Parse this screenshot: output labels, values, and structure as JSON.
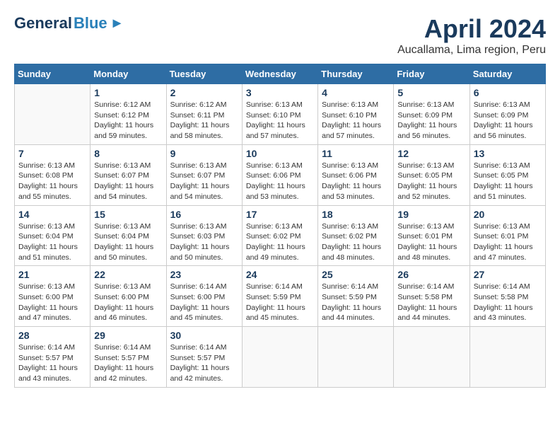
{
  "header": {
    "logo_general": "General",
    "logo_blue": "Blue",
    "title": "April 2024",
    "subtitle": "Aucallama, Lima region, Peru"
  },
  "calendar": {
    "days_of_week": [
      "Sunday",
      "Monday",
      "Tuesday",
      "Wednesday",
      "Thursday",
      "Friday",
      "Saturday"
    ],
    "weeks": [
      [
        {
          "day": "",
          "info": ""
        },
        {
          "day": "1",
          "info": "Sunrise: 6:12 AM\nSunset: 6:12 PM\nDaylight: 11 hours\nand 59 minutes."
        },
        {
          "day": "2",
          "info": "Sunrise: 6:12 AM\nSunset: 6:11 PM\nDaylight: 11 hours\nand 58 minutes."
        },
        {
          "day": "3",
          "info": "Sunrise: 6:13 AM\nSunset: 6:10 PM\nDaylight: 11 hours\nand 57 minutes."
        },
        {
          "day": "4",
          "info": "Sunrise: 6:13 AM\nSunset: 6:10 PM\nDaylight: 11 hours\nand 57 minutes."
        },
        {
          "day": "5",
          "info": "Sunrise: 6:13 AM\nSunset: 6:09 PM\nDaylight: 11 hours\nand 56 minutes."
        },
        {
          "day": "6",
          "info": "Sunrise: 6:13 AM\nSunset: 6:09 PM\nDaylight: 11 hours\nand 56 minutes."
        }
      ],
      [
        {
          "day": "7",
          "info": "Sunrise: 6:13 AM\nSunset: 6:08 PM\nDaylight: 11 hours\nand 55 minutes."
        },
        {
          "day": "8",
          "info": "Sunrise: 6:13 AM\nSunset: 6:07 PM\nDaylight: 11 hours\nand 54 minutes."
        },
        {
          "day": "9",
          "info": "Sunrise: 6:13 AM\nSunset: 6:07 PM\nDaylight: 11 hours\nand 54 minutes."
        },
        {
          "day": "10",
          "info": "Sunrise: 6:13 AM\nSunset: 6:06 PM\nDaylight: 11 hours\nand 53 minutes."
        },
        {
          "day": "11",
          "info": "Sunrise: 6:13 AM\nSunset: 6:06 PM\nDaylight: 11 hours\nand 53 minutes."
        },
        {
          "day": "12",
          "info": "Sunrise: 6:13 AM\nSunset: 6:05 PM\nDaylight: 11 hours\nand 52 minutes."
        },
        {
          "day": "13",
          "info": "Sunrise: 6:13 AM\nSunset: 6:05 PM\nDaylight: 11 hours\nand 51 minutes."
        }
      ],
      [
        {
          "day": "14",
          "info": "Sunrise: 6:13 AM\nSunset: 6:04 PM\nDaylight: 11 hours\nand 51 minutes."
        },
        {
          "day": "15",
          "info": "Sunrise: 6:13 AM\nSunset: 6:04 PM\nDaylight: 11 hours\nand 50 minutes."
        },
        {
          "day": "16",
          "info": "Sunrise: 6:13 AM\nSunset: 6:03 PM\nDaylight: 11 hours\nand 50 minutes."
        },
        {
          "day": "17",
          "info": "Sunrise: 6:13 AM\nSunset: 6:02 PM\nDaylight: 11 hours\nand 49 minutes."
        },
        {
          "day": "18",
          "info": "Sunrise: 6:13 AM\nSunset: 6:02 PM\nDaylight: 11 hours\nand 48 minutes."
        },
        {
          "day": "19",
          "info": "Sunrise: 6:13 AM\nSunset: 6:01 PM\nDaylight: 11 hours\nand 48 minutes."
        },
        {
          "day": "20",
          "info": "Sunrise: 6:13 AM\nSunset: 6:01 PM\nDaylight: 11 hours\nand 47 minutes."
        }
      ],
      [
        {
          "day": "21",
          "info": "Sunrise: 6:13 AM\nSunset: 6:00 PM\nDaylight: 11 hours\nand 47 minutes."
        },
        {
          "day": "22",
          "info": "Sunrise: 6:13 AM\nSunset: 6:00 PM\nDaylight: 11 hours\nand 46 minutes."
        },
        {
          "day": "23",
          "info": "Sunrise: 6:14 AM\nSunset: 6:00 PM\nDaylight: 11 hours\nand 45 minutes."
        },
        {
          "day": "24",
          "info": "Sunrise: 6:14 AM\nSunset: 5:59 PM\nDaylight: 11 hours\nand 45 minutes."
        },
        {
          "day": "25",
          "info": "Sunrise: 6:14 AM\nSunset: 5:59 PM\nDaylight: 11 hours\nand 44 minutes."
        },
        {
          "day": "26",
          "info": "Sunrise: 6:14 AM\nSunset: 5:58 PM\nDaylight: 11 hours\nand 44 minutes."
        },
        {
          "day": "27",
          "info": "Sunrise: 6:14 AM\nSunset: 5:58 PM\nDaylight: 11 hours\nand 43 minutes."
        }
      ],
      [
        {
          "day": "28",
          "info": "Sunrise: 6:14 AM\nSunset: 5:57 PM\nDaylight: 11 hours\nand 43 minutes."
        },
        {
          "day": "29",
          "info": "Sunrise: 6:14 AM\nSunset: 5:57 PM\nDaylight: 11 hours\nand 42 minutes."
        },
        {
          "day": "30",
          "info": "Sunrise: 6:14 AM\nSunset: 5:57 PM\nDaylight: 11 hours\nand 42 minutes."
        },
        {
          "day": "",
          "info": ""
        },
        {
          "day": "",
          "info": ""
        },
        {
          "day": "",
          "info": ""
        },
        {
          "day": "",
          "info": ""
        }
      ]
    ]
  }
}
